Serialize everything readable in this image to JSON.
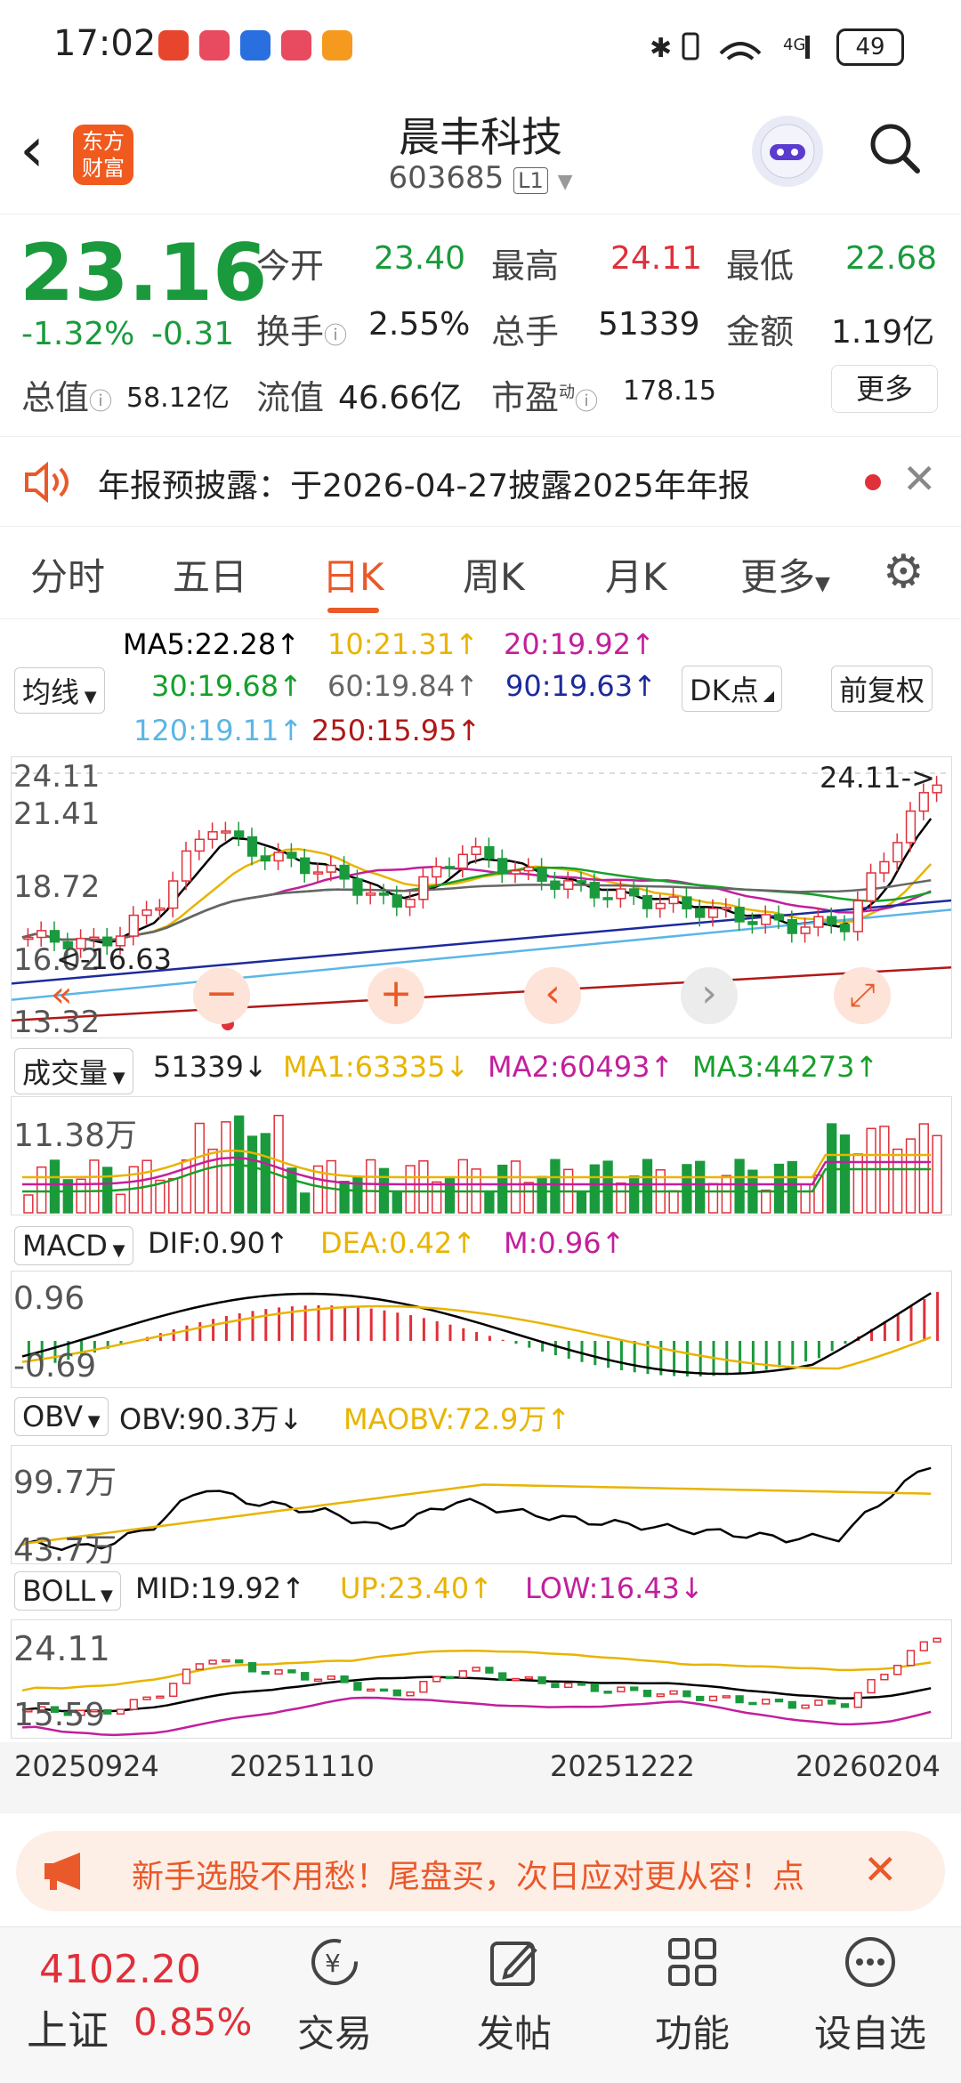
{
  "status_bar": {
    "time": "17:02",
    "battery": "49",
    "network": "4G"
  },
  "header": {
    "stock_name": "晨丰科技",
    "stock_code": "603685",
    "code_badge": "L1",
    "logo_text_line1": "东方",
    "logo_text_line2": "财富"
  },
  "quote": {
    "price": "23.16",
    "change_pct": "-1.32%",
    "change_amt": "-0.31",
    "fields": {
      "open_label": "今开",
      "open": "23.40",
      "high_label": "最高",
      "high": "24.11",
      "low_label": "最低",
      "low": "22.68",
      "turnover_label": "换手",
      "turnover": "2.55%",
      "volume_label": "总手",
      "volume": "51339",
      "amount_label": "金额",
      "amount": "1.19亿",
      "total_cap_label": "总值",
      "total_cap": "58.12亿",
      "float_cap_label": "流值",
      "float_cap": "46.66亿",
      "pe_label": "市盈",
      "pe_sup": "动",
      "pe": "178.15"
    },
    "more_button": "更多"
  },
  "notice": {
    "text": "年报预披露：于2026-04-27披露2025年年报"
  },
  "tabs": [
    "分时",
    "五日",
    "日K",
    "周K",
    "月K",
    "更多"
  ],
  "active_tab": "日K",
  "ma": {
    "selector": "均线",
    "ma5": "MA5:22.28↑",
    "ma10": "10:21.31↑",
    "ma20": "20:19.92↑",
    "ma30": "30:19.68↑",
    "ma60": "60:19.84↑",
    "ma90": "90:19.63↑",
    "ma120": "120:19.11↑",
    "ma250": "250:15.95↑",
    "dk_button": "DK点",
    "adjust_button": "前复权"
  },
  "kline": {
    "y_labels": [
      "24.11",
      "21.41",
      "18.72",
      "16.02",
      "13.32"
    ],
    "max_marker": "24.11->",
    "min_marker": "<-16.63"
  },
  "volume": {
    "selector": "成交量",
    "value": "51339↓",
    "ma1": "MA1:63335↓",
    "ma2": "MA2:60493↑",
    "ma3": "MA3:44273↑",
    "y_label": "11.38万"
  },
  "macd": {
    "selector": "MACD",
    "dif": "DIF:0.90↑",
    "dea": "DEA:0.42↑",
    "m": "M:0.96↑",
    "y_top": "0.96",
    "y_bottom": "-0.69"
  },
  "obv": {
    "selector": "OBV",
    "obv": "OBV:90.3万↓",
    "maobv": "MAOBV:72.9万↑",
    "y_top": "99.7万",
    "y_bottom": "43.7万"
  },
  "boll": {
    "selector": "BOLL",
    "mid": "MID:19.92↑",
    "up": "UP:23.40↑",
    "low": "LOW:16.43↓",
    "y_top": "24.11",
    "y_bottom": "15.59"
  },
  "dates": [
    "20250924",
    "20251110",
    "20251222",
    "20260204"
  ],
  "banner": {
    "text": "新手选股不用愁！尾盘买，次日应对更从容！点"
  },
  "bottom_nav": {
    "index_value": "4102.20",
    "index_name": "上证",
    "index_change": "0.85%",
    "items": [
      "交易",
      "发帖",
      "功能",
      "设自选"
    ]
  },
  "colors": {
    "up": "#e0303a",
    "down": "#1a9a3c",
    "accent": "#e9592a",
    "ma5": "#000000",
    "ma10": "#e8b400",
    "ma20": "#c21f9c",
    "ma30": "#16a02a",
    "ma60": "#666666",
    "ma90": "#1c2a9c",
    "ma120": "#5bb6e6",
    "ma250": "#b01818"
  }
}
